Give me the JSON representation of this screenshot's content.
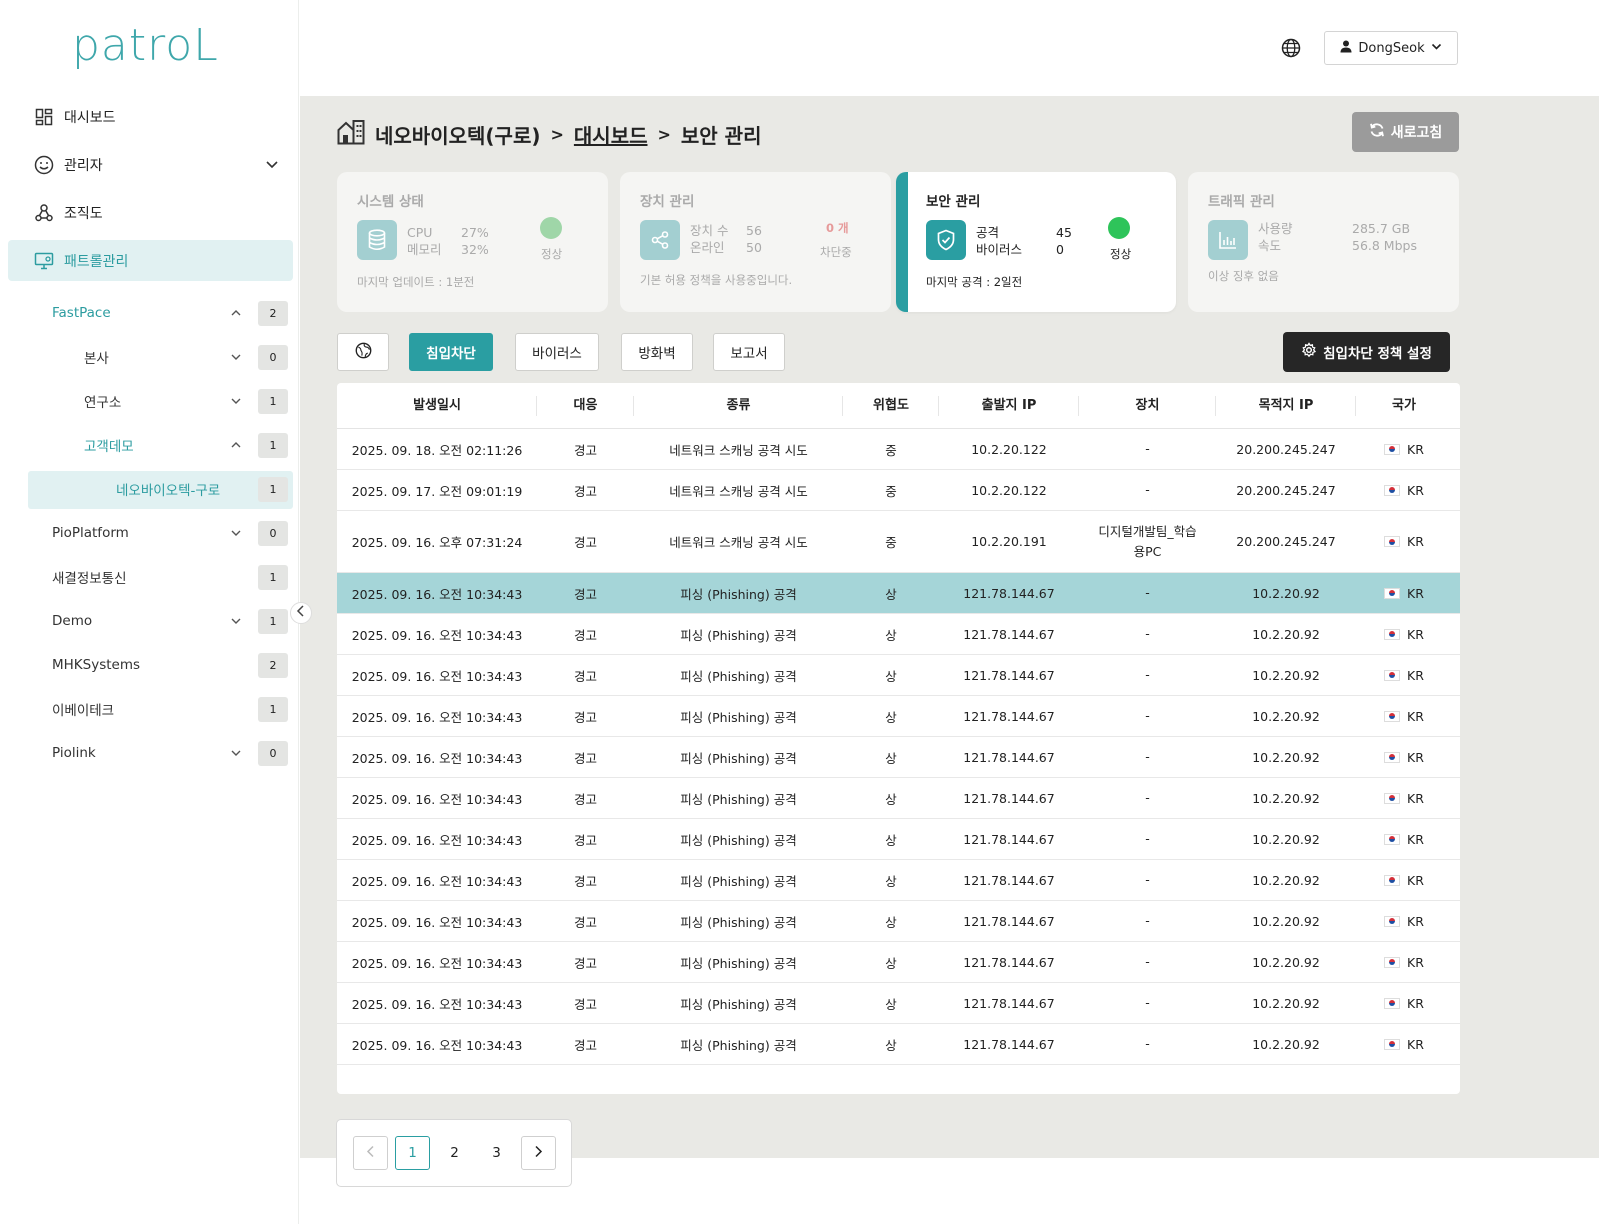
{
  "app": {
    "logo": "patroL"
  },
  "sidebar": {
    "nav": [
      {
        "label": "대시보드",
        "icon": "dashboard-grid-icon"
      },
      {
        "label": "관리자",
        "icon": "smiley-face-icon"
      },
      {
        "label": "조직도",
        "icon": "org-chart-icon"
      },
      {
        "label": "패트롤관리",
        "icon": "monitor-icon"
      }
    ],
    "tree": [
      {
        "label": "FastPace",
        "count": "2"
      },
      {
        "label": "본사",
        "count": "0"
      },
      {
        "label": "연구소",
        "count": "1"
      },
      {
        "label": "고객데모",
        "count": "1"
      },
      {
        "label": "네오바이오텍-구로",
        "count": "1"
      },
      {
        "label": "PioPlatform",
        "count": "0"
      },
      {
        "label": "새결정보통신",
        "count": "1"
      },
      {
        "label": "Demo",
        "count": "1"
      },
      {
        "label": "MHKSystems",
        "count": "2"
      },
      {
        "label": "이베이테크",
        "count": "1"
      },
      {
        "label": "Piolink",
        "count": "0"
      }
    ]
  },
  "topbar": {
    "user": "DongSeok"
  },
  "breadcrumb": {
    "site": "네오바이오텍(구로)",
    "sep1": ">",
    "link": "대시보드",
    "sep2": ">",
    "current": "보안 관리"
  },
  "refresh": {
    "label": "새로고침"
  },
  "cards": {
    "system": {
      "title": "시스템 상태",
      "k1": "CPU",
      "v1": "27%",
      "k2": "메모리",
      "v2": "32%",
      "status": "정상",
      "foot": "마지막 업데이트 : 1분전",
      "dot_color": "#9fd6a8"
    },
    "device": {
      "title": "장치 관리",
      "k1": "장치 수",
      "v1": "56",
      "k2": "온라인",
      "v2": "50",
      "blocked_count": "0 개",
      "blocked_label": "차단중",
      "foot": "기본 허용 정책을 사용중입니다."
    },
    "security": {
      "title": "보안 관리",
      "k1": "공격",
      "v1": "45",
      "k2": "바이러스",
      "v2": "0",
      "status": "정상",
      "foot": "마지막 공격 : 2일전",
      "dot_color": "#2ec45a"
    },
    "traffic": {
      "title": "트래픽 관리",
      "k1": "사용량",
      "v1": "285.7 GB",
      "k2": "속도",
      "v2": "56.8 Mbps",
      "foot": "이상 징후 없음"
    }
  },
  "tabs": {
    "t1": "침입차단",
    "t2": "바이러스",
    "t3": "방화벽",
    "t4": "보고서"
  },
  "policy_button": {
    "label": "침입차단 정책 설정"
  },
  "table": {
    "headers": [
      "발생일시",
      "대응",
      "종류",
      "위협도",
      "출발지 IP",
      "장치",
      "목적지 IP",
      "국가"
    ],
    "rows": [
      [
        "2025. 09. 18. 오전 02:11:26",
        "경고",
        "네트워크 스캐닝 공격 시도",
        "중",
        "10.2.20.122",
        "-",
        "20.200.245.247",
        "KR"
      ],
      [
        "2025. 09. 17. 오전 09:01:19",
        "경고",
        "네트워크 스캐닝 공격 시도",
        "중",
        "10.2.20.122",
        "-",
        "20.200.245.247",
        "KR"
      ],
      [
        "2025. 09. 16. 오후 07:31:24",
        "경고",
        "네트워크 스캐닝 공격 시도",
        "중",
        "10.2.20.191",
        "디지털개발팀_학습\n용PC",
        "20.200.245.247",
        "KR"
      ],
      [
        "2025. 09. 16. 오전 10:34:43",
        "경고",
        "피싱 (Phishing) 공격",
        "상",
        "121.78.144.67",
        "-",
        "10.2.20.92",
        "KR"
      ],
      [
        "2025. 09. 16. 오전 10:34:43",
        "경고",
        "피싱 (Phishing) 공격",
        "상",
        "121.78.144.67",
        "-",
        "10.2.20.92",
        "KR"
      ],
      [
        "2025. 09. 16. 오전 10:34:43",
        "경고",
        "피싱 (Phishing) 공격",
        "상",
        "121.78.144.67",
        "-",
        "10.2.20.92",
        "KR"
      ],
      [
        "2025. 09. 16. 오전 10:34:43",
        "경고",
        "피싱 (Phishing) 공격",
        "상",
        "121.78.144.67",
        "-",
        "10.2.20.92",
        "KR"
      ],
      [
        "2025. 09. 16. 오전 10:34:43",
        "경고",
        "피싱 (Phishing) 공격",
        "상",
        "121.78.144.67",
        "-",
        "10.2.20.92",
        "KR"
      ],
      [
        "2025. 09. 16. 오전 10:34:43",
        "경고",
        "피싱 (Phishing) 공격",
        "상",
        "121.78.144.67",
        "-",
        "10.2.20.92",
        "KR"
      ],
      [
        "2025. 09. 16. 오전 10:34:43",
        "경고",
        "피싱 (Phishing) 공격",
        "상",
        "121.78.144.67",
        "-",
        "10.2.20.92",
        "KR"
      ],
      [
        "2025. 09. 16. 오전 10:34:43",
        "경고",
        "피싱 (Phishing) 공격",
        "상",
        "121.78.144.67",
        "-",
        "10.2.20.92",
        "KR"
      ],
      [
        "2025. 09. 16. 오전 10:34:43",
        "경고",
        "피싱 (Phishing) 공격",
        "상",
        "121.78.144.67",
        "-",
        "10.2.20.92",
        "KR"
      ],
      [
        "2025. 09. 16. 오전 10:34:43",
        "경고",
        "피싱 (Phishing) 공격",
        "상",
        "121.78.144.67",
        "-",
        "10.2.20.92",
        "KR"
      ],
      [
        "2025. 09. 16. 오전 10:34:43",
        "경고",
        "피싱 (Phishing) 공격",
        "상",
        "121.78.144.67",
        "-",
        "10.2.20.92",
        "KR"
      ],
      [
        "2025. 09. 16. 오전 10:34:43",
        "경고",
        "피싱 (Phishing) 공격",
        "상",
        "121.78.144.67",
        "-",
        "10.2.20.92",
        "KR"
      ]
    ],
    "highlight_row": 3,
    "highlight_color": "#a5d5d8"
  },
  "pagination": {
    "pages": [
      "1",
      "2",
      "3"
    ],
    "current": "1"
  },
  "colors": {
    "accent": "#2a9ea2",
    "dark_button": "#262626"
  }
}
